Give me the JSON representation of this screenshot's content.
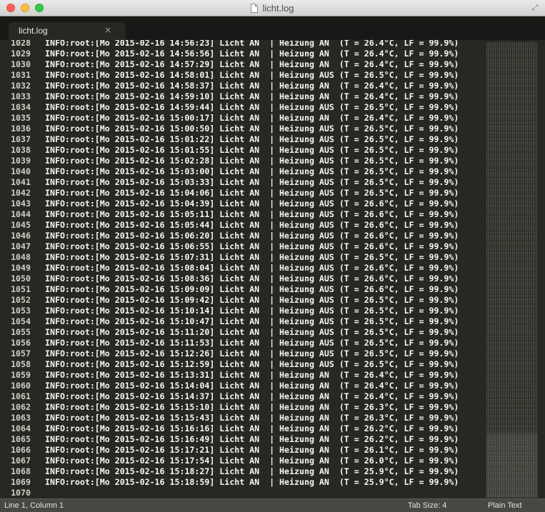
{
  "window": {
    "title": "licht.log",
    "fullscreen_glyph": "⤢"
  },
  "tabs": [
    {
      "label": "licht.log",
      "close_glyph": "×"
    }
  ],
  "editor": {
    "lines": [
      {
        "num": "1028",
        "text": "INFO:root:[Mo 2015-02-16 14:56:23] Licht AN  | Heizung AN  (T = 26.4°C, LF = 99.9%)"
      },
      {
        "num": "1029",
        "text": "INFO:root:[Mo 2015-02-16 14:56:56] Licht AN  | Heizung AN  (T = 26.4°C, LF = 99.9%)"
      },
      {
        "num": "1030",
        "text": "INFO:root:[Mo 2015-02-16 14:57:29] Licht AN  | Heizung AN  (T = 26.4°C, LF = 99.9%)"
      },
      {
        "num": "1031",
        "text": "INFO:root:[Mo 2015-02-16 14:58:01] Licht AN  | Heizung AUS (T = 26.5°C, LF = 99.9%)"
      },
      {
        "num": "1032",
        "text": "INFO:root:[Mo 2015-02-16 14:58:37] Licht AN  | Heizung AN  (T = 26.4°C, LF = 99.9%)"
      },
      {
        "num": "1033",
        "text": "INFO:root:[Mo 2015-02-16 14:59:10] Licht AN  | Heizung AN  (T = 26.4°C, LF = 99.9%)"
      },
      {
        "num": "1034",
        "text": "INFO:root:[Mo 2015-02-16 14:59:44] Licht AN  | Heizung AUS (T = 26.5°C, LF = 99.9%)"
      },
      {
        "num": "1035",
        "text": "INFO:root:[Mo 2015-02-16 15:00:17] Licht AN  | Heizung AN  (T = 26.4°C, LF = 99.9%)"
      },
      {
        "num": "1036",
        "text": "INFO:root:[Mo 2015-02-16 15:00:50] Licht AN  | Heizung AUS (T = 26.5°C, LF = 99.9%)"
      },
      {
        "num": "1037",
        "text": "INFO:root:[Mo 2015-02-16 15:01:22] Licht AN  | Heizung AUS (T = 26.5°C, LF = 99.9%)"
      },
      {
        "num": "1038",
        "text": "INFO:root:[Mo 2015-02-16 15:01:55] Licht AN  | Heizung AUS (T = 26.5°C, LF = 99.9%)"
      },
      {
        "num": "1039",
        "text": "INFO:root:[Mo 2015-02-16 15:02:28] Licht AN  | Heizung AUS (T = 26.5°C, LF = 99.9%)"
      },
      {
        "num": "1040",
        "text": "INFO:root:[Mo 2015-02-16 15:03:00] Licht AN  | Heizung AUS (T = 26.5°C, LF = 99.9%)"
      },
      {
        "num": "1041",
        "text": "INFO:root:[Mo 2015-02-16 15:03:33] Licht AN  | Heizung AUS (T = 26.5°C, LF = 99.9%)"
      },
      {
        "num": "1042",
        "text": "INFO:root:[Mo 2015-02-16 15:04:06] Licht AN  | Heizung AUS (T = 26.5°C, LF = 99.9%)"
      },
      {
        "num": "1043",
        "text": "INFO:root:[Mo 2015-02-16 15:04:39] Licht AN  | Heizung AUS (T = 26.6°C, LF = 99.9%)"
      },
      {
        "num": "1044",
        "text": "INFO:root:[Mo 2015-02-16 15:05:11] Licht AN  | Heizung AUS (T = 26.6°C, LF = 99.9%)"
      },
      {
        "num": "1045",
        "text": "INFO:root:[Mo 2015-02-16 15:05:44] Licht AN  | Heizung AUS (T = 26.6°C, LF = 99.9%)"
      },
      {
        "num": "1046",
        "text": "INFO:root:[Mo 2015-02-16 15:06:20] Licht AN  | Heizung AUS (T = 26.6°C, LF = 99.9%)"
      },
      {
        "num": "1047",
        "text": "INFO:root:[Mo 2015-02-16 15:06:55] Licht AN  | Heizung AUS (T = 26.6°C, LF = 99.9%)"
      },
      {
        "num": "1048",
        "text": "INFO:root:[Mo 2015-02-16 15:07:31] Licht AN  | Heizung AUS (T = 26.5°C, LF = 99.9%)"
      },
      {
        "num": "1049",
        "text": "INFO:root:[Mo 2015-02-16 15:08:04] Licht AN  | Heizung AUS (T = 26.6°C, LF = 99.9%)"
      },
      {
        "num": "1050",
        "text": "INFO:root:[Mo 2015-02-16 15:08:36] Licht AN  | Heizung AUS (T = 26.6°C, LF = 99.9%)"
      },
      {
        "num": "1051",
        "text": "INFO:root:[Mo 2015-02-16 15:09:09] Licht AN  | Heizung AUS (T = 26.6°C, LF = 99.9%)"
      },
      {
        "num": "1052",
        "text": "INFO:root:[Mo 2015-02-16 15:09:42] Licht AN  | Heizung AUS (T = 26.5°C, LF = 99.9%)"
      },
      {
        "num": "1053",
        "text": "INFO:root:[Mo 2015-02-16 15:10:14] Licht AN  | Heizung AUS (T = 26.5°C, LF = 99.9%)"
      },
      {
        "num": "1054",
        "text": "INFO:root:[Mo 2015-02-16 15:10:47] Licht AN  | Heizung AUS (T = 26.5°C, LF = 99.9%)"
      },
      {
        "num": "1055",
        "text": "INFO:root:[Mo 2015-02-16 15:11:20] Licht AN  | Heizung AUS (T = 26.5°C, LF = 99.9%)"
      },
      {
        "num": "1056",
        "text": "INFO:root:[Mo 2015-02-16 15:11:53] Licht AN  | Heizung AUS (T = 26.5°C, LF = 99.9%)"
      },
      {
        "num": "1057",
        "text": "INFO:root:[Mo 2015-02-16 15:12:26] Licht AN  | Heizung AUS (T = 26.5°C, LF = 99.9%)"
      },
      {
        "num": "1058",
        "text": "INFO:root:[Mo 2015-02-16 15:12:59] Licht AN  | Heizung AUS (T = 26.5°C, LF = 99.9%)"
      },
      {
        "num": "1059",
        "text": "INFO:root:[Mo 2015-02-16 15:13:31] Licht AN  | Heizung AN  (T = 26.4°C, LF = 99.9%)"
      },
      {
        "num": "1060",
        "text": "INFO:root:[Mo 2015-02-16 15:14:04] Licht AN  | Heizung AN  (T = 26.4°C, LF = 99.9%)"
      },
      {
        "num": "1061",
        "text": "INFO:root:[Mo 2015-02-16 15:14:37] Licht AN  | Heizung AN  (T = 26.4°C, LF = 99.9%)"
      },
      {
        "num": "1062",
        "text": "INFO:root:[Mo 2015-02-16 15:15:10] Licht AN  | Heizung AN  (T = 26.3°C, LF = 99.9%)"
      },
      {
        "num": "1063",
        "text": "INFO:root:[Mo 2015-02-16 15:15:43] Licht AN  | Heizung AN  (T = 26.3°C, LF = 99.9%)"
      },
      {
        "num": "1064",
        "text": "INFO:root:[Mo 2015-02-16 15:16:16] Licht AN  | Heizung AN  (T = 26.2°C, LF = 99.9%)"
      },
      {
        "num": "1065",
        "text": "INFO:root:[Mo 2015-02-16 15:16:49] Licht AN  | Heizung AN  (T = 26.2°C, LF = 99.9%)"
      },
      {
        "num": "1066",
        "text": "INFO:root:[Mo 2015-02-16 15:17:21] Licht AN  | Heizung AN  (T = 26.1°C, LF = 99.9%)"
      },
      {
        "num": "1067",
        "text": "INFO:root:[Mo 2015-02-16 15:17:54] Licht AN  | Heizung AN  (T = 26.0°C, LF = 99.9%)"
      },
      {
        "num": "1068",
        "text": "INFO:root:[Mo 2015-02-16 15:18:27] Licht AN  | Heizung AN  (T = 25.9°C, LF = 99.9%)"
      },
      {
        "num": "1069",
        "text": "INFO:root:[Mo 2015-02-16 15:18:59] Licht AN  | Heizung AN  (T = 25.9°C, LF = 99.9%)"
      },
      {
        "num": "1070",
        "text": ""
      }
    ]
  },
  "status": {
    "position": "Line 1, Column 1",
    "tab_size": "Tab Size: 4",
    "syntax": "Plain Text"
  },
  "colors": {
    "background": "#272822",
    "text": "#f8f8f2",
    "status_bar": "#474841",
    "tab_bar": "#181916"
  }
}
